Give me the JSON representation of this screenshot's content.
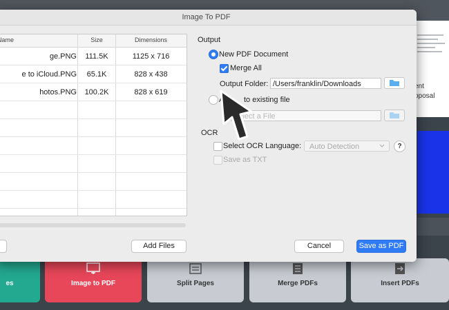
{
  "dialog": {
    "title": "Image To PDF"
  },
  "table": {
    "headers": {
      "name": "Name",
      "size": "Size",
      "dimensions": "Dimensions"
    },
    "rows": [
      {
        "name": "ge.PNG",
        "size": "111.5K",
        "dimensions": "1125 x 716"
      },
      {
        "name": "e to iCloud.PNG",
        "size": "65.1K",
        "dimensions": "828 x 438"
      },
      {
        "name": "hotos.PNG",
        "size": "100.2K",
        "dimensions": "828 x 619"
      }
    ]
  },
  "buttons": {
    "left_partial": "ll",
    "add_files": "Add Files",
    "cancel": "Cancel",
    "save_as_pdf": "Save as PDF"
  },
  "output": {
    "section_label": "Output",
    "new_pdf_label": "New PDF Document",
    "merge_all_label": "Merge All",
    "output_folder_label": "Output Folder:",
    "output_folder_value": "/Users/franklin/Downloads",
    "append_label_visible": "to existing file",
    "append_label_partial": "A",
    "select_file_placeholder": "Select a File"
  },
  "ocr": {
    "section_label": "OCR",
    "select_language_label": "Select OCR Language:",
    "language_value": "Auto Detection",
    "help_label": "?",
    "save_as_txt_label": "Save as TXT"
  },
  "background": {
    "doc_text_1": "ent",
    "doc_text_2": "oposal",
    "tiles": [
      {
        "label": "es"
      },
      {
        "label": "Image to PDF"
      },
      {
        "label": "Split Pages"
      },
      {
        "label": "Merge PDFs"
      },
      {
        "label": "Insert PDFs"
      }
    ]
  },
  "colors": {
    "accent": "#2f7bf6",
    "folder_icon": "#5aaef0",
    "tile_green": "#22a98f",
    "tile_red": "#e8475a"
  }
}
